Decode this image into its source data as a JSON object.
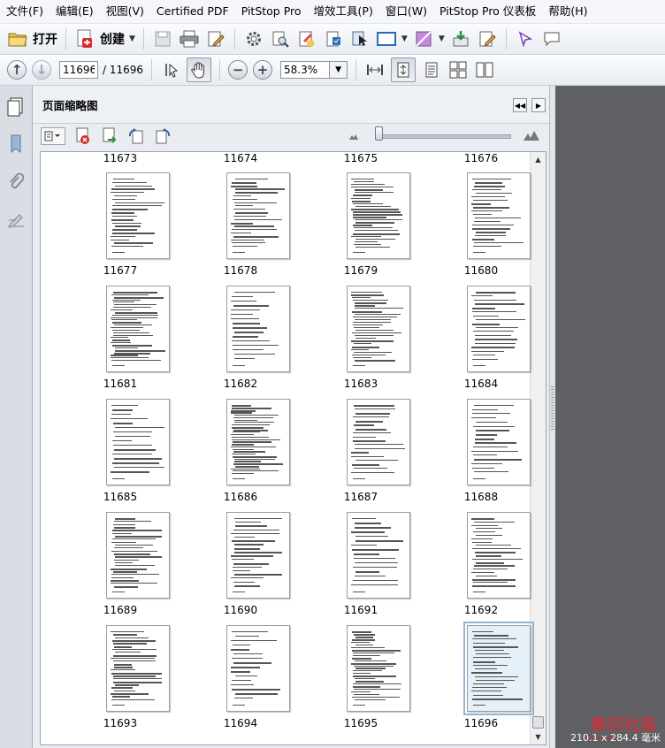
{
  "menu": [
    "文件(F)",
    "编辑(E)",
    "视图(V)",
    "Certified PDF",
    "PitStop Pro",
    "增效工具(P)",
    "窗口(W)",
    "PitStop Pro 仪表板",
    "帮助(H)"
  ],
  "toolbar": {
    "open_label": "打开",
    "create_label": "创建"
  },
  "nav": {
    "current_page": "11696",
    "total_pages": "/ 11696",
    "zoom": "58.3%"
  },
  "panel": {
    "title": "页面缩略图"
  },
  "thumbnails": {
    "top_labels": [
      "11673",
      "11674",
      "11675",
      "11676"
    ],
    "rows": [
      [
        "11677",
        "11678",
        "11679",
        "11680"
      ],
      [
        "11681",
        "11682",
        "11683",
        "11684"
      ],
      [
        "11685",
        "11686",
        "11687",
        "11688"
      ],
      [
        "11689",
        "11690",
        "11691",
        "11692"
      ],
      [
        "11693",
        "11694",
        "11695",
        "11696"
      ]
    ],
    "selected": "11696"
  },
  "status": {
    "page_size": "210.1 x 284.4 毫米"
  },
  "watermark": {
    "text": "華印社區",
    "sub": "52cnp.com"
  },
  "colors": {
    "doc_background": "#5f6063",
    "selected_outline": "#8fb6d8",
    "watermark": "#c8323c"
  }
}
